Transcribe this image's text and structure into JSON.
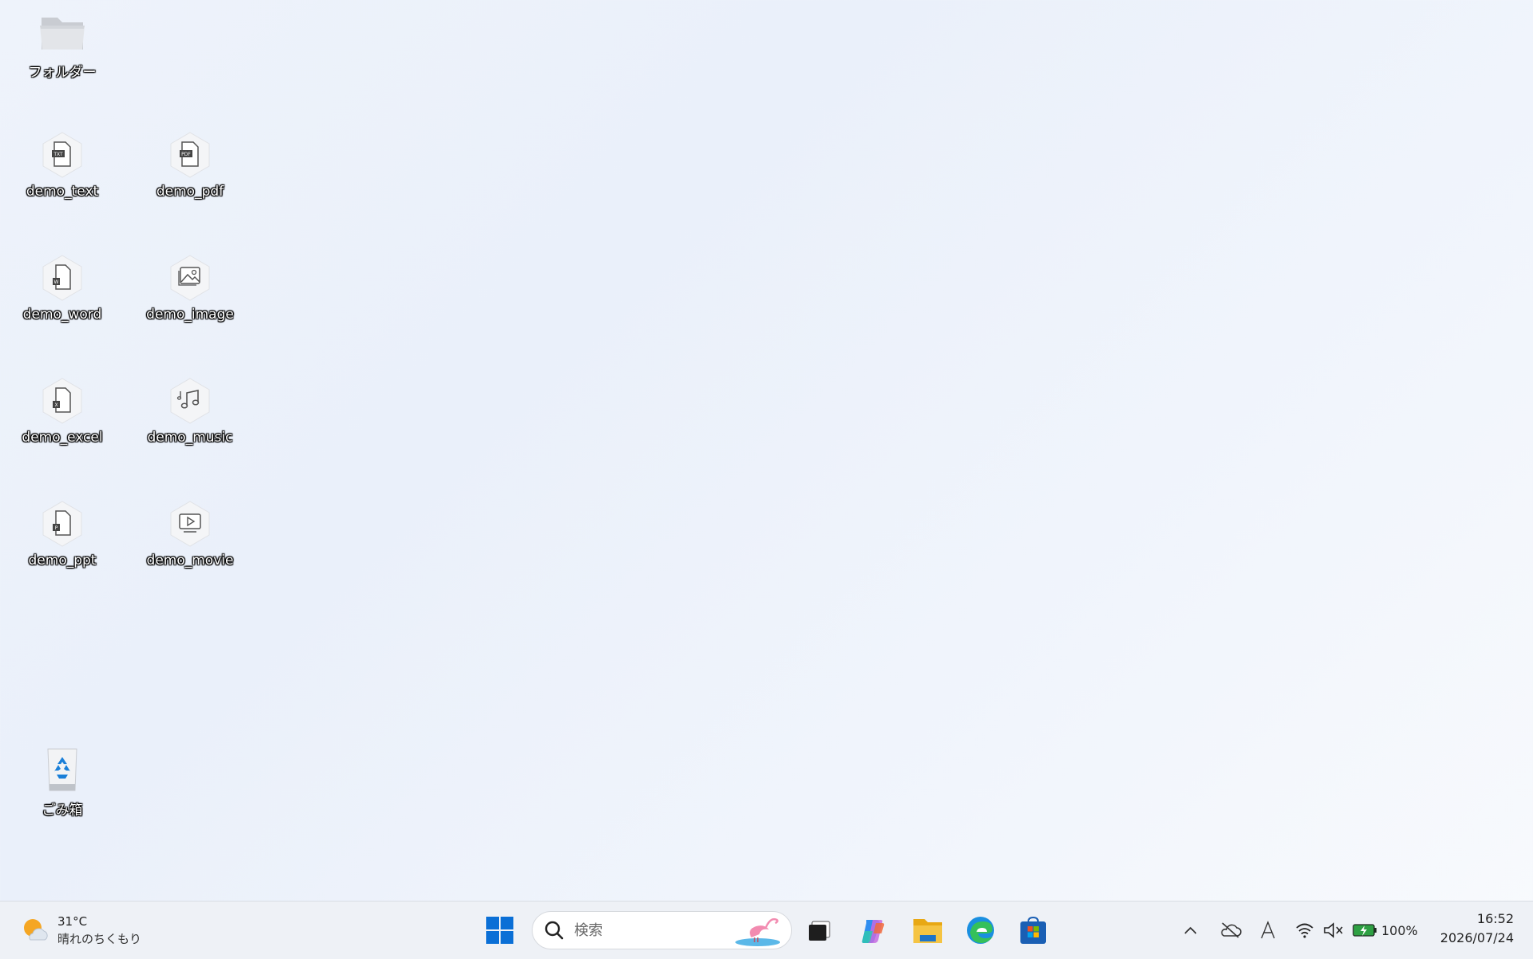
{
  "desktop": {
    "icons": [
      {
        "label": "フォルダー",
        "icon": "folder-icon"
      },
      {
        "label": "demo_text",
        "icon": "txt-file-icon"
      },
      {
        "label": "demo_pdf",
        "icon": "pdf-file-icon"
      },
      {
        "label": "demo_word",
        "icon": "word-file-icon"
      },
      {
        "label": "demo_image",
        "icon": "image-file-icon"
      },
      {
        "label": "demo_excel",
        "icon": "excel-file-icon"
      },
      {
        "label": "demo_music",
        "icon": "music-file-icon"
      },
      {
        "label": "demo_ppt",
        "icon": "ppt-file-icon"
      },
      {
        "label": "demo_movie",
        "icon": "movie-file-icon"
      },
      {
        "label": "ごみ箱",
        "icon": "recycle-bin-icon"
      }
    ]
  },
  "taskbar": {
    "weather": {
      "temp": "31°C",
      "condition": "晴れのちくもり"
    },
    "search": {
      "placeholder": "検索"
    },
    "battery": {
      "percent": "100%"
    },
    "clock": {
      "time": "16:52",
      "date": "2026/07/24"
    },
    "colors": {
      "start_blue": "#0a6fd6",
      "edge_blue": "#1a8fe0",
      "folder_yellow": "#f5c443",
      "battery_green": "#2ea043"
    }
  }
}
